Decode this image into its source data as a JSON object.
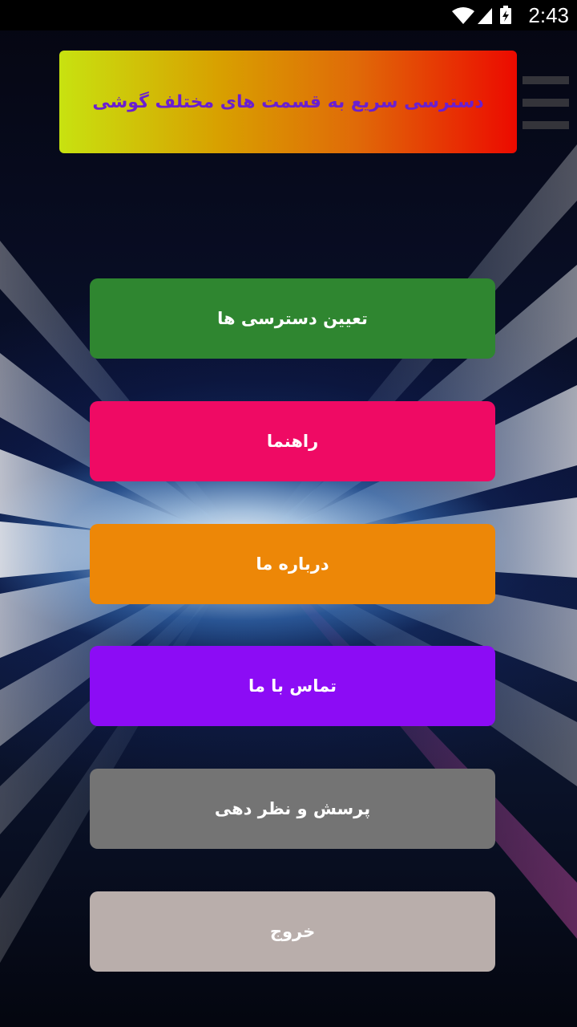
{
  "status_bar": {
    "time": "2:43",
    "icons": [
      "wifi-icon",
      "signal-icon",
      "battery-charging-icon"
    ]
  },
  "header": {
    "title": "دسترسی سریع به قسمت های مختلف گوشی"
  },
  "menu_icon": "hamburger-menu-icon",
  "buttons": [
    {
      "id": "permissions",
      "label": "تعیین دسترسی ها",
      "color": "#2f8630"
    },
    {
      "id": "guide",
      "label": "راهنما",
      "color": "#ef0a64"
    },
    {
      "id": "about",
      "label": "درباره ما",
      "color": "#ed8707"
    },
    {
      "id": "contact",
      "label": "تماس با ما",
      "color": "#8c0cf5"
    },
    {
      "id": "feedback",
      "label": "پرسش و نظر دهی",
      "color": "#747474"
    },
    {
      "id": "exit",
      "label": "خروج",
      "color": "#b9aeab"
    }
  ],
  "colors": {
    "header_gradient_start": "#c8e210",
    "header_gradient_end": "#ec0a00",
    "header_text": "#6a1fd0"
  }
}
